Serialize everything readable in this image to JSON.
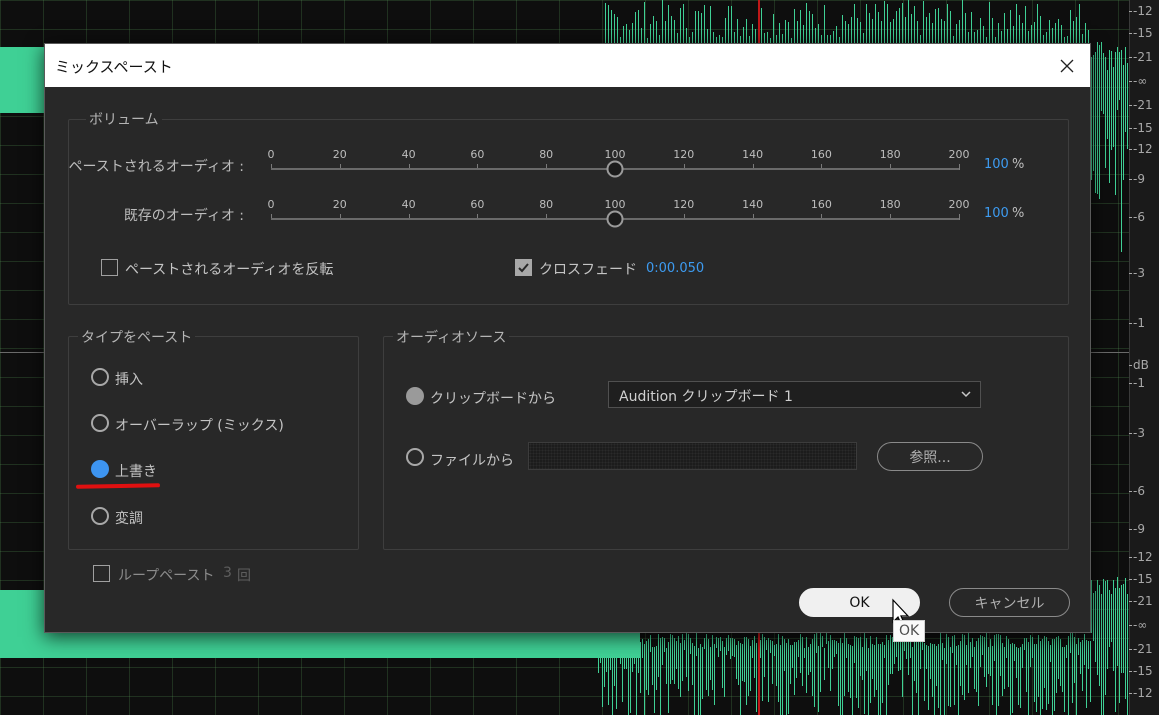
{
  "dialog": {
    "title": "ミックスペースト",
    "volume": {
      "group_label": "ボリューム",
      "scale_ticks": [
        "0",
        "20",
        "40",
        "60",
        "80",
        "100",
        "120",
        "140",
        "160",
        "180",
        "200"
      ],
      "pasted_label": "ペーストされるオーディオ :",
      "pasted_value": "100",
      "pasted_percent": 100,
      "existing_label": "既存のオーディオ :",
      "existing_value": "100",
      "existing_percent": 100,
      "unit": "%",
      "invert_label": "ペーストされるオーディオを反転",
      "invert_checked": false,
      "crossfade_label": "クロスフェード",
      "crossfade_checked": true,
      "crossfade_value": "0:00.050"
    },
    "paste_type": {
      "group_label": "タイプをペースト",
      "options": [
        "挿入",
        "オーバーラップ (ミックス)",
        "上書き",
        "変調"
      ],
      "selected": "上書き"
    },
    "loop": {
      "label": "ループペースト",
      "checked": false,
      "count_value": "3",
      "count_unit": "回"
    },
    "audio_source": {
      "group_label": "オーディオソース",
      "clipboard_label": "クリップボードから",
      "clipboard_selected": "Audition クリップボード 1",
      "file_label": "ファイルから",
      "browse_label": "参照..."
    },
    "ok_label": "OK",
    "cancel_label": "キャンセル",
    "tooltip": "OK"
  },
  "ruler_labels": [
    "-12",
    "-15",
    "-21",
    "-∞",
    "-21",
    "-15",
    "-12",
    "-9",
    "-6",
    "-3",
    "-1",
    "dB",
    "-1",
    "-3",
    "-6",
    "-9",
    "-12",
    "-15",
    "-21",
    "-∞",
    "-21",
    "-15",
    "-12"
  ],
  "colors": {
    "accent_blue": "#3d9bf0",
    "waveform_green": "#3fd095",
    "annotation_red": "#e01010"
  }
}
